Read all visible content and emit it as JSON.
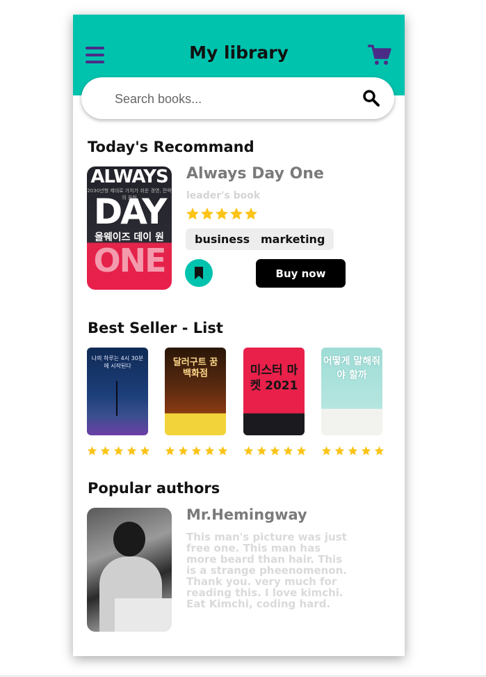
{
  "header": {
    "title": "My library",
    "menu_icon": "hamburger-menu-icon",
    "cart_icon": "shopping-cart-icon",
    "accent_color": "#00c3ae",
    "icon_color": "#4a2c87"
  },
  "search": {
    "placeholder": "Search books...",
    "value": "",
    "icon": "search-icon"
  },
  "recommend": {
    "section_title": "Today's Recommand",
    "book_title": "Always Day One",
    "subtitle": "leader's book",
    "rating": 5,
    "rating_max": 5,
    "tags": [
      "business",
      "marketing"
    ],
    "buy_label": "Buy now",
    "bookmark_icon": "bookmark-icon",
    "cover": {
      "line1": "ALWAYS",
      "line2": "2030년형 제대로 가치가 쉬운 경영, 전략의 원칙",
      "line3": "DAY",
      "line4": "올웨이즈 데이 원",
      "line5": "ONE"
    }
  },
  "bestseller": {
    "section_title": "Best Seller - List",
    "books": [
      {
        "cover_text": "나의 하루는 4시 30분에 시작된다",
        "rating": 5
      },
      {
        "cover_text": "달러구트 꿈 백화점",
        "rating": 5
      },
      {
        "cover_text": "미스터 마켓 2021",
        "rating": 5
      },
      {
        "cover_text": "어떻게 말해줘야 할까",
        "rating": 5
      }
    ]
  },
  "authors": {
    "section_title": "Popular authors",
    "name": "Mr.Hemingway",
    "description": "This man's picture was just free one. This man has more beard than hair. This is a strange pheenomenon. Thank you. very much for reading this. I love kimchi. Eat Kimchi, coding hard."
  },
  "star_color": "#fcc419"
}
